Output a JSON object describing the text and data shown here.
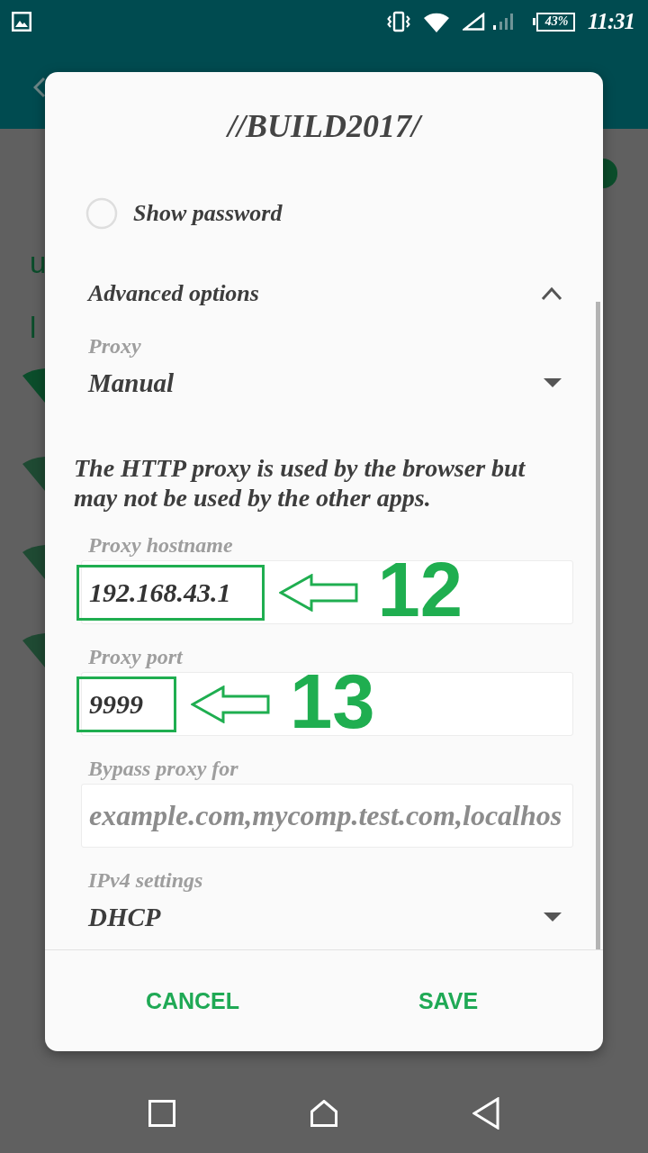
{
  "status_bar": {
    "battery": "43%",
    "time": "11:31"
  },
  "background": {
    "partial_texts": [
      "u",
      "l"
    ]
  },
  "dialog": {
    "title": "//BUILD2017/",
    "show_password": {
      "label": "Show password",
      "checked": false
    },
    "advanced_options": {
      "label": "Advanced options",
      "expanded": true
    },
    "items": [
      {
        "kind": "dropdown",
        "label": "Proxy",
        "value": "Manual"
      },
      {
        "kind": "note",
        "text": "The HTTP proxy is used by the browser but may not be used by the other apps."
      },
      {
        "kind": "input",
        "label": "Proxy hostname",
        "value": "192.168.43.1",
        "highlighted": true,
        "callout": "12"
      },
      {
        "kind": "input",
        "label": "Proxy port",
        "value": "9999",
        "highlighted": true,
        "callout": "13"
      },
      {
        "kind": "input",
        "label": "Bypass proxy for",
        "placeholder": "example.com,mycomp.test.com,localhos"
      },
      {
        "kind": "dropdown",
        "label": "IPv4 settings",
        "value": "DHCP"
      }
    ],
    "buttons": [
      "CANCEL",
      "SAVE"
    ]
  }
}
